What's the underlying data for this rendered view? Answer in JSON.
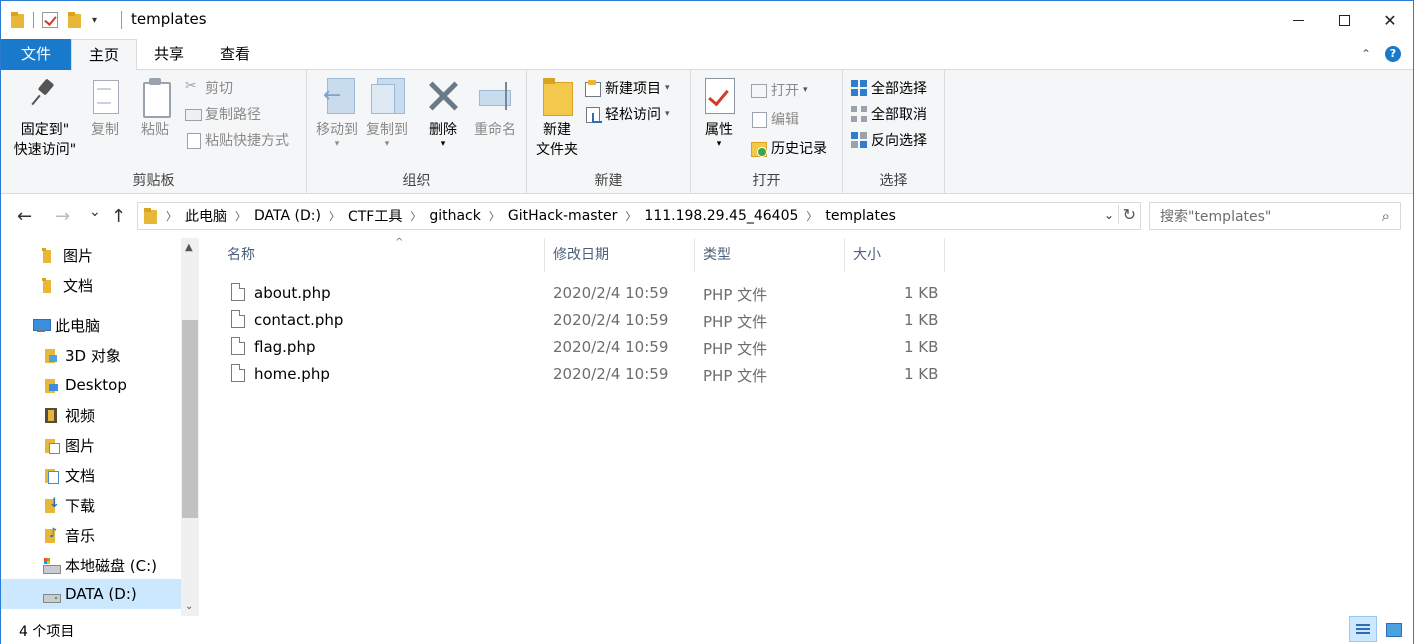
{
  "window": {
    "title": "templates",
    "minimize_glyph": "",
    "maximize_glyph": "",
    "close_glyph": "✕",
    "qat_dropdown": "▾"
  },
  "ribbon_tabs": {
    "file": "文件",
    "home": "主页",
    "share": "共享",
    "view": "查看",
    "expand_glyph": "⌃",
    "help_glyph": "?"
  },
  "ribbon": {
    "clipboard": {
      "label": "剪贴板",
      "pin_quick_access": "固定到\"\n快速访问\"",
      "pin_line1": "固定到\"",
      "pin_line2": "快速访问\"",
      "copy": "复制",
      "paste": "粘贴",
      "cut": "剪切",
      "copy_path": "复制路径",
      "paste_shortcut": "粘贴快捷方式"
    },
    "organize": {
      "label": "组织",
      "move_to": "移动到",
      "copy_to": "复制到",
      "delete": "删除",
      "rename": "重命名"
    },
    "new": {
      "label": "新建",
      "new_folder_line1": "新建",
      "new_folder_line2": "文件夹",
      "new_item": "新建项目",
      "easy_access": "轻松访问"
    },
    "open": {
      "label": "打开",
      "properties": "属性",
      "open": "打开",
      "edit": "编辑",
      "history": "历史记录"
    },
    "select": {
      "label": "选择",
      "select_all": "全部选择",
      "select_none": "全部取消",
      "invert_selection": "反向选择"
    }
  },
  "nav": {
    "back": "←",
    "forward": "→",
    "recent": "⌄",
    "up": "↑"
  },
  "address": {
    "crumbs": [
      "此电脑",
      "DATA (D:)",
      "CTF工具",
      "githack",
      "GitHack-master",
      "111.198.29.45_46405",
      "templates"
    ],
    "dropdown": "⌄",
    "refresh": "↻"
  },
  "search": {
    "placeholder": "搜索\"templates\"",
    "icon": "⌕"
  },
  "navpane": {
    "items": [
      {
        "label": "图片",
        "icon": "folder-icon"
      },
      {
        "label": "文档",
        "icon": "folder-icon"
      },
      {
        "label": "此电脑",
        "icon": "computer-icon"
      },
      {
        "label": "3D 对象",
        "icon": "3d-objects-icon"
      },
      {
        "label": "Desktop",
        "icon": "desktop-icon"
      },
      {
        "label": "视频",
        "icon": "videos-icon"
      },
      {
        "label": "图片",
        "icon": "pictures-icon"
      },
      {
        "label": "文档",
        "icon": "documents-icon"
      },
      {
        "label": "下载",
        "icon": "downloads-icon"
      },
      {
        "label": "音乐",
        "icon": "music-icon"
      },
      {
        "label": "本地磁盘 (C:)",
        "icon": "drive-c-icon"
      },
      {
        "label": "DATA (D:)",
        "icon": "drive-d-icon"
      }
    ],
    "scroll_up": "▲",
    "scroll_down": "⌄"
  },
  "filelist": {
    "columns": {
      "name": "名称",
      "modified": "修改日期",
      "type": "类型",
      "size": "大小"
    },
    "sort_indicator": "^",
    "rows": [
      {
        "name": "about.php",
        "modified": "2020/2/4 10:59",
        "type": "PHP 文件",
        "size": "1 KB"
      },
      {
        "name": "contact.php",
        "modified": "2020/2/4 10:59",
        "type": "PHP 文件",
        "size": "1 KB"
      },
      {
        "name": "flag.php",
        "modified": "2020/2/4 10:59",
        "type": "PHP 文件",
        "size": "1 KB"
      },
      {
        "name": "home.php",
        "modified": "2020/2/4 10:59",
        "type": "PHP 文件",
        "size": "1 KB"
      }
    ]
  },
  "statusbar": {
    "item_count": "4 个项目"
  },
  "colors": {
    "accent": "#1979ca",
    "selection": "#cce8ff",
    "ribbon_bg": "#f5f6f7",
    "header_text": "#4c607a"
  }
}
